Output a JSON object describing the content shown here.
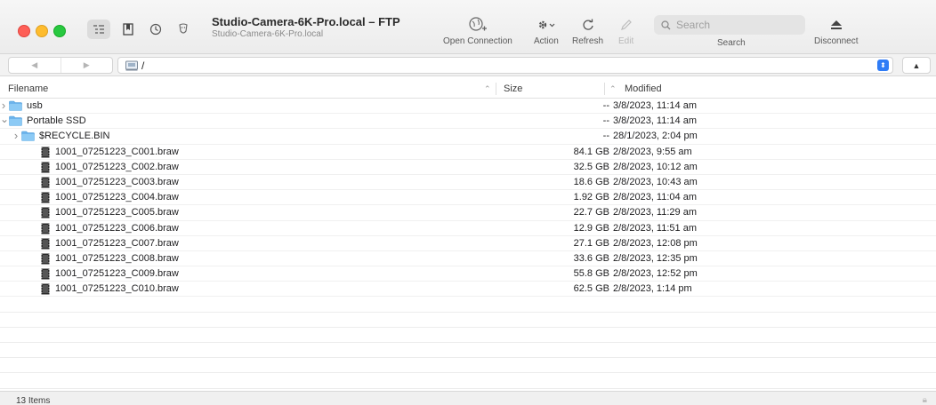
{
  "window": {
    "title": "Studio-Camera-6K-Pro.local – FTP",
    "subtitle": "Studio-Camera-6K-Pro.local"
  },
  "toolbar": {
    "open_connection": "Open Connection",
    "action": "Action",
    "refresh": "Refresh",
    "edit": "Edit",
    "search_label": "Search",
    "search_placeholder": "Search",
    "disconnect": "Disconnect"
  },
  "pathbar": {
    "path": "/"
  },
  "columns": {
    "filename": "Filename",
    "size": "Size",
    "modified": "Modified"
  },
  "rows": [
    {
      "name": "usb",
      "type": "folder",
      "indent": 0,
      "disclosure": "collapsed",
      "size": "--",
      "modified": "3/8/2023, 11:14 am"
    },
    {
      "name": "Portable SSD",
      "type": "folder",
      "indent": 0,
      "disclosure": "expanded",
      "size": "--",
      "modified": "3/8/2023, 11:14 am"
    },
    {
      "name": "$RECYCLE.BIN",
      "type": "folder",
      "indent": 1,
      "disclosure": "collapsed",
      "size": "--",
      "modified": "28/1/2023, 2:04 pm"
    },
    {
      "name": "1001_07251223_C001.braw",
      "type": "file",
      "indent": 1,
      "size": "84.1 GB",
      "modified": "2/8/2023, 9:55 am"
    },
    {
      "name": "1001_07251223_C002.braw",
      "type": "file",
      "indent": 1,
      "size": "32.5 GB",
      "modified": "2/8/2023, 10:12 am"
    },
    {
      "name": "1001_07251223_C003.braw",
      "type": "file",
      "indent": 1,
      "size": "18.6 GB",
      "modified": "2/8/2023, 10:43 am"
    },
    {
      "name": "1001_07251223_C004.braw",
      "type": "file",
      "indent": 1,
      "size": "1.92 GB",
      "modified": "2/8/2023, 11:04 am"
    },
    {
      "name": "1001_07251223_C005.braw",
      "type": "file",
      "indent": 1,
      "size": "22.7 GB",
      "modified": "2/8/2023, 11:29 am"
    },
    {
      "name": "1001_07251223_C006.braw",
      "type": "file",
      "indent": 1,
      "size": "12.9 GB",
      "modified": "2/8/2023, 11:51 am"
    },
    {
      "name": "1001_07251223_C007.braw",
      "type": "file",
      "indent": 1,
      "size": "27.1 GB",
      "modified": "2/8/2023, 12:08 pm"
    },
    {
      "name": "1001_07251223_C008.braw",
      "type": "file",
      "indent": 1,
      "size": "33.6 GB",
      "modified": "2/8/2023, 12:35 pm"
    },
    {
      "name": "1001_07251223_C009.braw",
      "type": "file",
      "indent": 1,
      "size": "55.8 GB",
      "modified": "2/8/2023, 12:52 pm"
    },
    {
      "name": "1001_07251223_C010.braw",
      "type": "file",
      "indent": 1,
      "size": "62.5 GB",
      "modified": "2/8/2023, 1:14 pm"
    }
  ],
  "status": {
    "item_count": "13 Items"
  }
}
